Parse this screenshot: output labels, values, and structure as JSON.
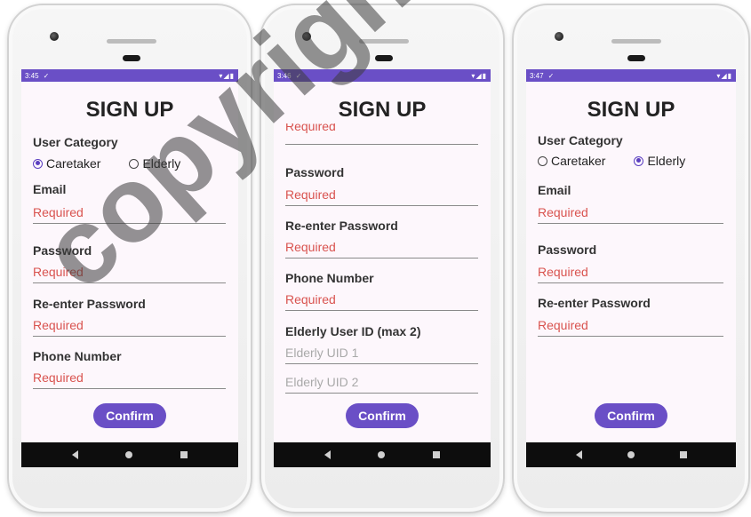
{
  "status_times": [
    "3:45",
    "3:46",
    "3:47"
  ],
  "title": "SIGN UP",
  "user_category_label": "User Category",
  "radio_caretaker": "Caretaker",
  "radio_elderly": "Elderly",
  "email_label": "Email",
  "password_label": "Password",
  "reenter_label": "Re-enter Password",
  "phone_label": "Phone Number",
  "elderly_id_label": "Elderly User ID (max 2)",
  "required_text": "Required",
  "uid1_hint": "Elderly UID 1",
  "uid2_hint": "Elderly UID 2",
  "confirm_label": "Confirm",
  "watermark": "copyright UKM",
  "colors": {
    "accent": "#6a4fc6",
    "error": "#d9534f",
    "screen_bg": "#fdf7fc"
  }
}
